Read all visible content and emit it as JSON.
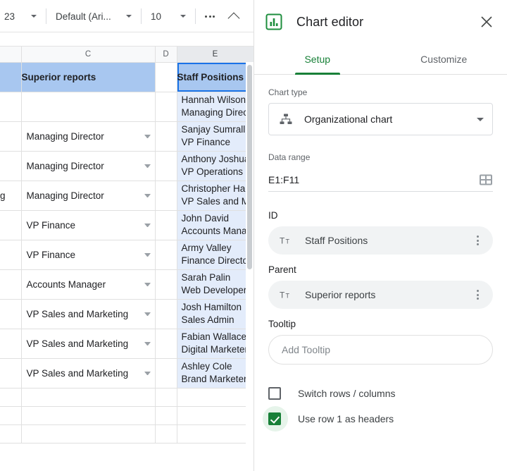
{
  "toolbar": {
    "zoom_or_size": "23",
    "font_name": "Default (Ari...",
    "font_size": "10",
    "more_label": "more-options",
    "collapse_label": "collapse-toolbar"
  },
  "spreadsheet": {
    "column_headers": [
      "",
      "C",
      "D",
      "E"
    ],
    "selected_column": "E",
    "rows": [
      {
        "b": "",
        "c": "Superior reports",
        "d": "",
        "e_line1": "Staff Positions",
        "e_line2": "",
        "header": true
      },
      {
        "b": "",
        "c": "",
        "d": "",
        "e_line1": "Hannah Wilson",
        "e_line2": "Managing Director"
      },
      {
        "b": "",
        "c": "Managing Director",
        "d": "",
        "e_line1": "Sanjay Sumrall",
        "e_line2": "VP Finance"
      },
      {
        "b": "",
        "c": "Managing Director",
        "d": "",
        "e_line1": "Anthony Joshua",
        "e_line2": "VP Operations"
      },
      {
        "b": "g",
        "c": "Managing Director",
        "d": "",
        "e_line1": "Christopher Hale",
        "e_line2": "VP Sales and Marketing"
      },
      {
        "b": "",
        "c": "VP Finance",
        "d": "",
        "e_line1": "John David",
        "e_line2": "Accounts Manager"
      },
      {
        "b": "",
        "c": "VP Finance",
        "d": "",
        "e_line1": "Army Valley",
        "e_line2": "Finance Director"
      },
      {
        "b": "",
        "c": "Accounts Manager",
        "d": "",
        "e_line1": "Sarah Palin",
        "e_line2": "Web Developer"
      },
      {
        "b": "",
        "c": "VP Sales and Marketing",
        "d": "",
        "e_line1": "Josh Hamilton",
        "e_line2": "Sales Admin"
      },
      {
        "b": "",
        "c": "VP Sales and Marketing",
        "d": "",
        "e_line1": "Fabian Wallace",
        "e_line2": "Digital Marketer"
      },
      {
        "b": "",
        "c": "VP Sales and Marketing",
        "d": "",
        "e_line1": "Ashley Cole",
        "e_line2": "Brand Marketer"
      },
      {
        "b": "",
        "c": "",
        "d": "",
        "e_line1": "",
        "e_line2": ""
      },
      {
        "b": "",
        "c": "",
        "d": "",
        "e_line1": "",
        "e_line2": ""
      },
      {
        "b": "",
        "c": "",
        "d": "",
        "e_line1": "",
        "e_line2": ""
      }
    ],
    "colors": {
      "header_fill": "#a8c7f0",
      "selection_fill": "#e3ecfb",
      "selection_border": "#1a73e8",
      "column_header_selected": "#e8eaed"
    }
  },
  "chart_editor": {
    "title": "Chart editor",
    "logo_icon": "bar-chart-icon",
    "close_icon": "close-icon",
    "tabs": [
      {
        "label": "Setup",
        "active": true
      },
      {
        "label": "Customize",
        "active": false
      }
    ],
    "chart_type": {
      "label": "Chart type",
      "value": "Organizational chart",
      "icon": "org-chart-icon"
    },
    "data_range": {
      "label": "Data range",
      "value": "E1:F11",
      "icon": "select-range-grid-icon"
    },
    "id": {
      "label": "ID",
      "value": "Staff Positions",
      "icon": "text-format-icon",
      "menu_icon": "more-vert-icon"
    },
    "parent": {
      "label": "Parent",
      "value": "Superior reports",
      "icon": "text-format-icon",
      "menu_icon": "more-vert-icon"
    },
    "tooltip": {
      "label": "Tooltip",
      "placeholder": "Add Tooltip"
    },
    "checkboxes": [
      {
        "label": "Switch rows / columns",
        "checked": false
      },
      {
        "label": "Use row 1 as headers",
        "checked": true
      }
    ],
    "accent_color": "#188038"
  }
}
